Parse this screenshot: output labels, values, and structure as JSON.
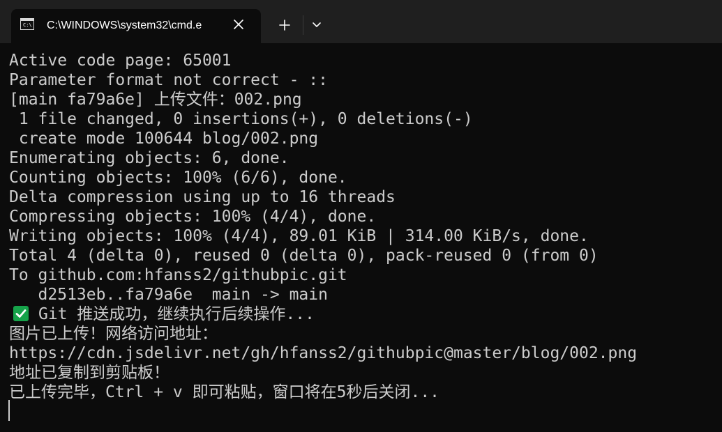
{
  "window": {
    "tab_title": "C:\\WINDOWS\\system32\\cmd.e",
    "colors": {
      "background": "#0c0c0c",
      "tab_strip": "#1f1f1f",
      "text": "#cccccc",
      "check_green": "#16a34a"
    }
  },
  "icons": {
    "terminal": "terminal-icon",
    "close": "close-icon",
    "new_tab": "plus-icon",
    "dropdown": "chevron-down-icon",
    "success": "check-mark-icon"
  },
  "terminal": {
    "lines": [
      "Active code page: 65001",
      "Parameter format not correct - ::",
      "[main fa79a6e] 上传文件：002.png",
      " 1 file changed, 0 insertions(+), 0 deletions(-)",
      " create mode 100644 blog/002.png",
      "Enumerating objects: 6, done.",
      "Counting objects: 100% (6/6), done.",
      "Delta compression using up to 16 threads",
      "Compressing objects: 100% (4/4), done.",
      "Writing objects: 100% (4/4), 89.01 KiB | 314.00 KiB/s, done.",
      "Total 4 (delta 0), reused 0 (delta 0), pack-reused 0 (from 0)",
      "To github.com:hfanss2/githubpic.git",
      "   d2513eb..fa79a6e  main -> main",
      "Git 推送成功，继续执行后续操作...",
      "图片已上传！网络访问地址：",
      "https://cdn.jsdelivr.net/gh/hfanss2/githubpic@master/blog/002.png",
      "地址已复制到剪贴板！",
      "已上传完毕，Ctrl + v 即可粘贴，窗口将在5秒后关闭..."
    ]
  }
}
